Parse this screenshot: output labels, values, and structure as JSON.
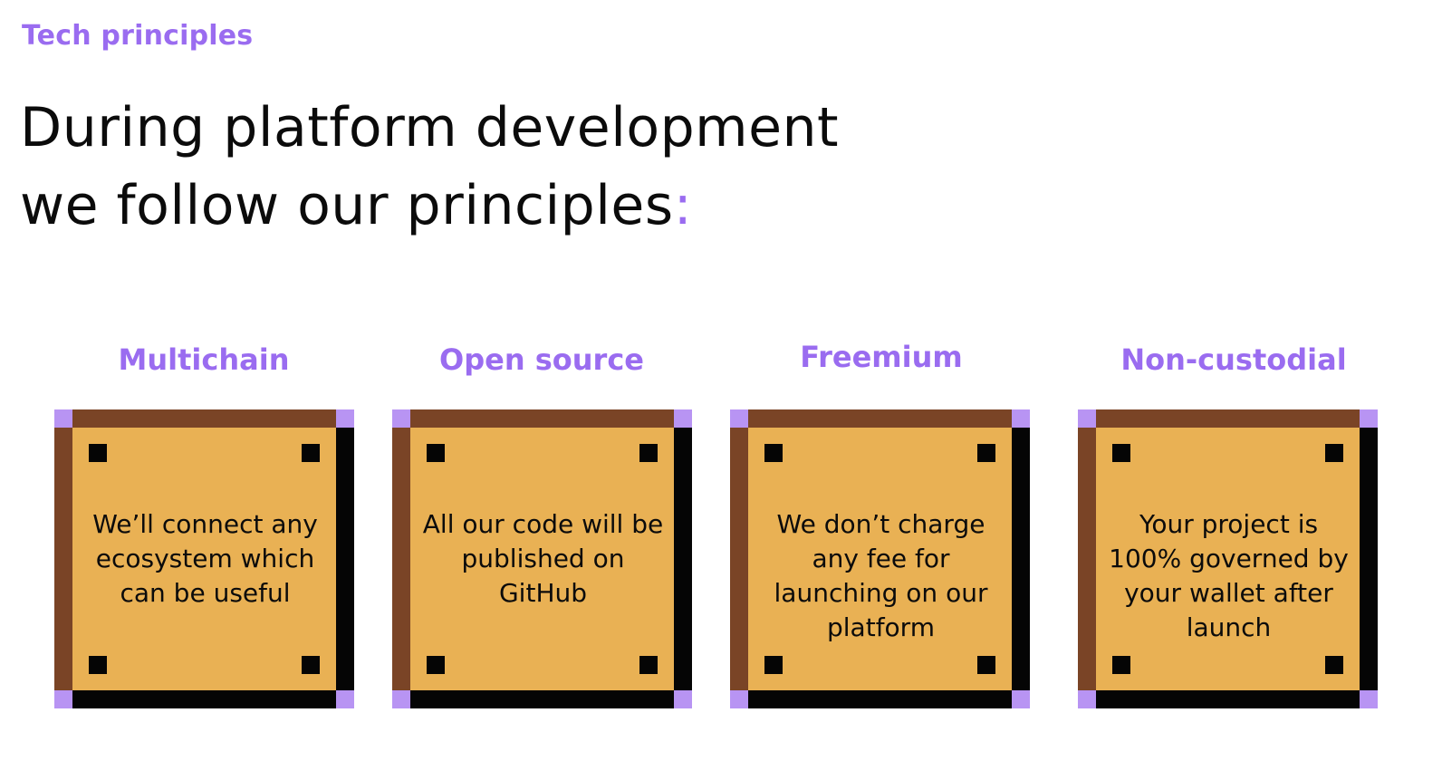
{
  "section": {
    "eyebrow": "Tech principles",
    "heading_line1": "During platform development",
    "heading_line2": "we follow our principles",
    "heading_colon": ":"
  },
  "principles": [
    {
      "title": "Multichain",
      "text": "We’ll connect any ecosystem which can be useful"
    },
    {
      "title": "Open source",
      "text": "All our code will be published on GitHub"
    },
    {
      "title": "Freemium",
      "text": "We don’t charge any fee for launching on our platform"
    },
    {
      "title": "Non-custodial",
      "text": "Your project is 100% governed by your wallet after launch"
    }
  ],
  "colors": {
    "accent": "#9a6cf0",
    "block_fill": "#e9b154",
    "block_highlight": "#7a4426",
    "block_shadow": "#050505",
    "block_corner": "#b894f3"
  }
}
